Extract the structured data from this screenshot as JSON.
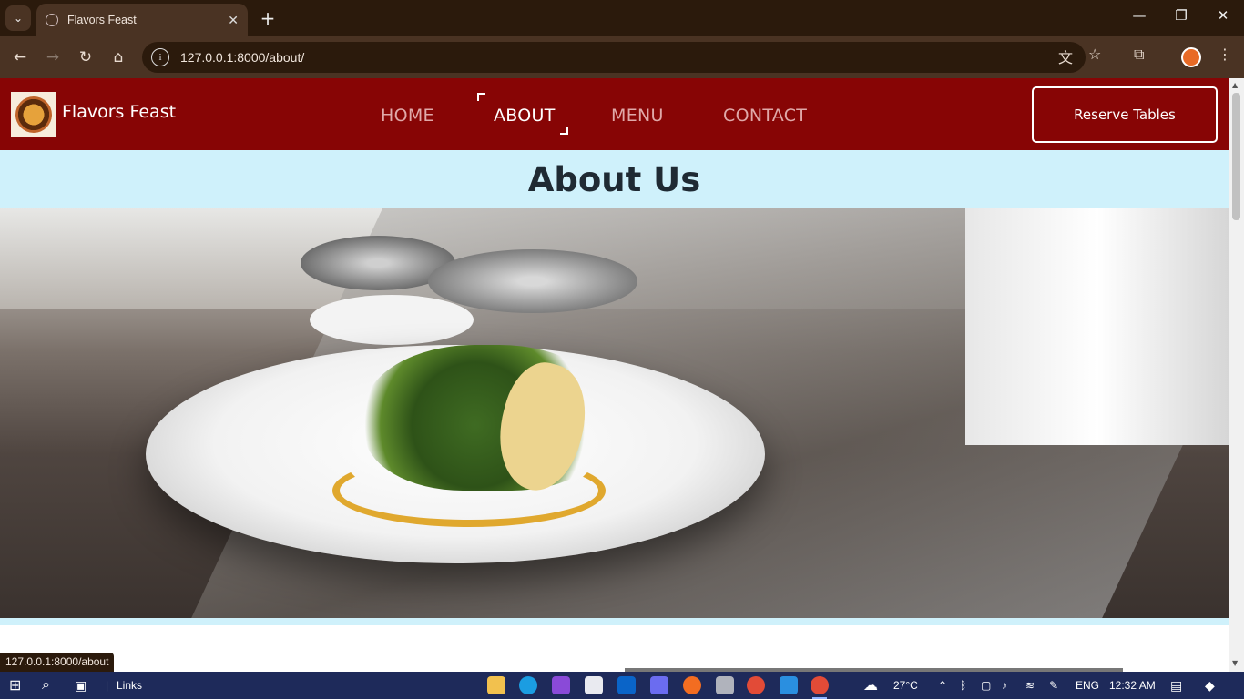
{
  "browser": {
    "tab_title": "Flavors Feast",
    "tab_close": "✕",
    "new_tab": "+",
    "url": "127.0.0.1:8000/about/",
    "status_url": "127.0.0.1:8000/about",
    "window_controls": {
      "minimize": "—",
      "restore": "❐",
      "close": "✕"
    },
    "icons": [
      "back-icon",
      "forward-icon",
      "reload-icon",
      "home-icon",
      "translate-icon",
      "star-icon",
      "extensions-icon",
      "menu-icon"
    ]
  },
  "site": {
    "brand": "Flavors Feast",
    "nav": [
      {
        "label": "HOME",
        "active": false
      },
      {
        "label": "ABOUT",
        "active": true
      },
      {
        "label": "MENU",
        "active": false
      },
      {
        "label": "CONTACT",
        "active": false
      }
    ],
    "reserve_label": "Reserve Tables",
    "heading": "About Us",
    "colors": {
      "navbar": "#870505",
      "heading_band": "#cff1fb"
    }
  },
  "taskbar": {
    "links_label": "Links",
    "temperature": "27°C",
    "language": "ENG",
    "time": "12:32 AM"
  }
}
